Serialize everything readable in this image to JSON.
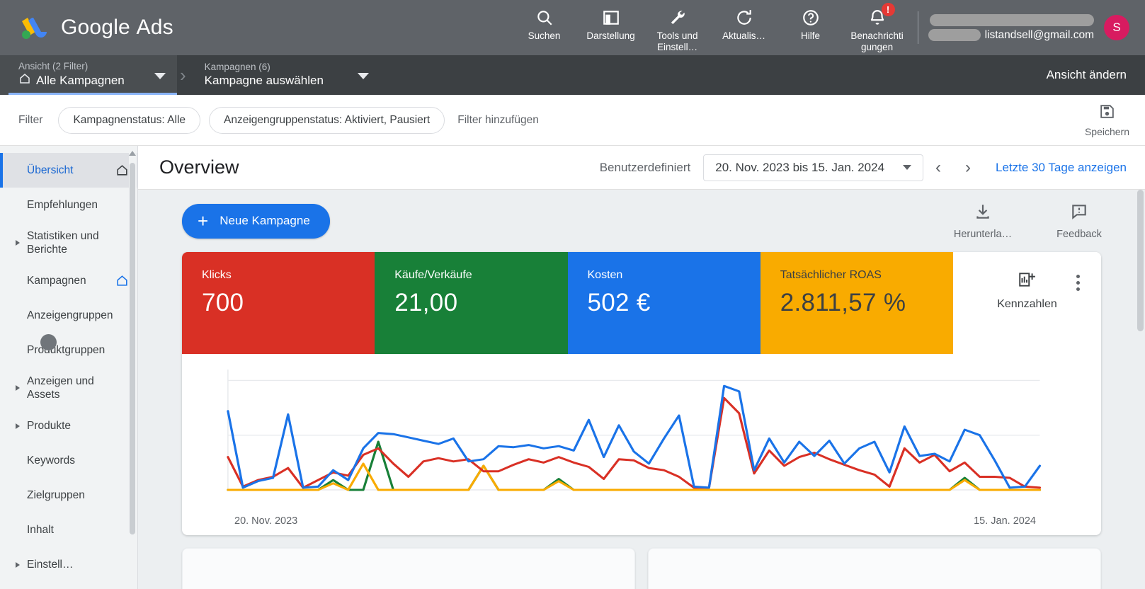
{
  "topbar": {
    "brand_bold": "Google",
    "brand_light": "Ads",
    "nav": [
      {
        "label": "Suchen",
        "icon": "search-icon"
      },
      {
        "label": "Darstellung",
        "icon": "chart-bar-icon"
      },
      {
        "label": "Tools und Einstell…",
        "icon": "wrench-icon"
      },
      {
        "label": "Aktualis…",
        "icon": "refresh-icon"
      },
      {
        "label": "Hilfe",
        "icon": "help-circle-icon"
      },
      {
        "label": "Benachrichti gungen",
        "icon": "bell-icon",
        "badge": "!"
      }
    ],
    "account_email": "listandsell@gmail.com",
    "avatar_initial": "S"
  },
  "breadcrumb": {
    "items": [
      {
        "top": "Ansicht (2 Filter)",
        "bottom": "Alle Kampagnen",
        "has_home": true,
        "active": true
      },
      {
        "top": "Kampagnen (6)",
        "bottom": "Kampagne auswählen",
        "has_home": false,
        "active": false
      }
    ],
    "view_change": "Ansicht ändern"
  },
  "filterbar": {
    "label": "Filter",
    "chips": [
      "Kampagnenstatus: Alle",
      "Anzeigengruppenstatus: Aktiviert, Pausiert"
    ],
    "add_filter": "Filter hinzufügen",
    "save_label": "Speichern"
  },
  "sidebar": {
    "items": [
      {
        "label": "Übersicht",
        "active": true,
        "expandable": false,
        "home": "home-outline"
      },
      {
        "label": "Empfehlungen",
        "active": false,
        "expandable": false
      },
      {
        "label": "Statistiken und Berichte",
        "active": false,
        "expandable": true,
        "two_line": true
      },
      {
        "label": "Kampagnen",
        "active": false,
        "expandable": false,
        "home": "home-blue"
      },
      {
        "label": "Anzeigengruppen",
        "active": false,
        "expandable": false
      },
      {
        "label": "Produktgruppen",
        "active": false,
        "expandable": false
      },
      {
        "label": "Anzeigen und Assets",
        "active": false,
        "expandable": true,
        "two_line": true
      },
      {
        "label": "Produkte",
        "active": false,
        "expandable": true
      },
      {
        "label": "Keywords",
        "active": false,
        "expandable": false
      },
      {
        "label": "Zielgruppen",
        "active": false,
        "expandable": false
      },
      {
        "label": "Inhalt",
        "active": false,
        "expandable": false
      },
      {
        "label": "Einstell…",
        "active": false,
        "expandable": true
      }
    ]
  },
  "main": {
    "page_title": "Overview",
    "date_preset": "Benutzerdefiniert",
    "date_range": "20. Nov. 2023 bis 15. Jan. 2024",
    "prev_arrow": "‹",
    "next_arrow": "›",
    "compare_link": "Letzte 30 Tage anzeigen",
    "new_campaign": "Neue Kampagne",
    "download_label": "Herunterla…",
    "feedback_label": "Feedback",
    "metrics_label": "Kennzahlen"
  },
  "chart_data": {
    "type": "line",
    "title": "",
    "xlabel": "",
    "ylabel": "",
    "x_tick_labels": [
      "20. Nov. 2023",
      "15. Jan. 2024"
    ],
    "grid": true,
    "legend_position": "none",
    "gridlines_y": [
      0,
      50,
      100
    ],
    "ylim": [
      0,
      110
    ],
    "kpis": [
      {
        "label": "Klicks",
        "value": "700",
        "color": "#d93025",
        "text_color": "#ffffff"
      },
      {
        "label": "Käufe/Verkäufe",
        "value": "21,00",
        "color": "#188038",
        "text_color": "#ffffff"
      },
      {
        "label": "Kosten",
        "value": "502 €",
        "color": "#1a73e8",
        "text_color": "#ffffff"
      },
      {
        "label": "Tatsächlicher ROAS",
        "value": "2.811,57 %",
        "color": "#f9ab00",
        "text_color": "#3c4043"
      }
    ],
    "series": [
      {
        "name": "Kosten",
        "color": "#1a73e8",
        "values": [
          72,
          2,
          8,
          11,
          69,
          2,
          3,
          18,
          9,
          38,
          52,
          51,
          48,
          45,
          42,
          47,
          26,
          28,
          40,
          39,
          41,
          38,
          40,
          36,
          64,
          30,
          59,
          35,
          24,
          47,
          68,
          3,
          2,
          95,
          90,
          18,
          47,
          25,
          44,
          31,
          45,
          24,
          38,
          44,
          16,
          58,
          31,
          33,
          26,
          55,
          50,
          27,
          2,
          3,
          22
        ]
      },
      {
        "name": "Klicks",
        "color": "#d93025",
        "values": [
          30,
          3,
          9,
          12,
          20,
          2,
          9,
          16,
          13,
          32,
          38,
          24,
          12,
          26,
          29,
          26,
          28,
          17,
          17,
          23,
          28,
          25,
          30,
          25,
          21,
          10,
          28,
          27,
          20,
          18,
          12,
          2,
          2,
          84,
          70,
          15,
          36,
          22,
          30,
          34,
          28,
          23,
          18,
          14,
          3,
          38,
          25,
          32,
          17,
          25,
          12,
          12,
          11,
          3,
          2
        ]
      },
      {
        "name": "Käufe/Verkäufe",
        "color": "#188038",
        "values": [
          0,
          0,
          0,
          0,
          0,
          0,
          0,
          9,
          0,
          0,
          44,
          0,
          0,
          0,
          0,
          0,
          0,
          22,
          0,
          0,
          0,
          0,
          10,
          0,
          0,
          0,
          0,
          0,
          0,
          0,
          0,
          0,
          0,
          0,
          0,
          0,
          0,
          0,
          0,
          0,
          0,
          0,
          0,
          0,
          0,
          0,
          0,
          0,
          0,
          11,
          0,
          0,
          0,
          0,
          0
        ]
      },
      {
        "name": "Tatsächlicher ROAS",
        "color": "#f9ab00",
        "values": [
          0,
          0,
          0,
          0,
          0,
          0,
          0,
          6,
          0,
          24,
          0,
          0,
          0,
          0,
          0,
          0,
          0,
          22,
          0,
          0,
          0,
          0,
          8,
          0,
          0,
          0,
          0,
          0,
          0,
          0,
          0,
          0,
          0,
          0,
          0,
          0,
          0,
          0,
          0,
          0,
          0,
          0,
          0,
          0,
          0,
          0,
          0,
          0,
          0,
          9,
          0,
          0,
          0,
          0,
          0
        ]
      }
    ]
  }
}
